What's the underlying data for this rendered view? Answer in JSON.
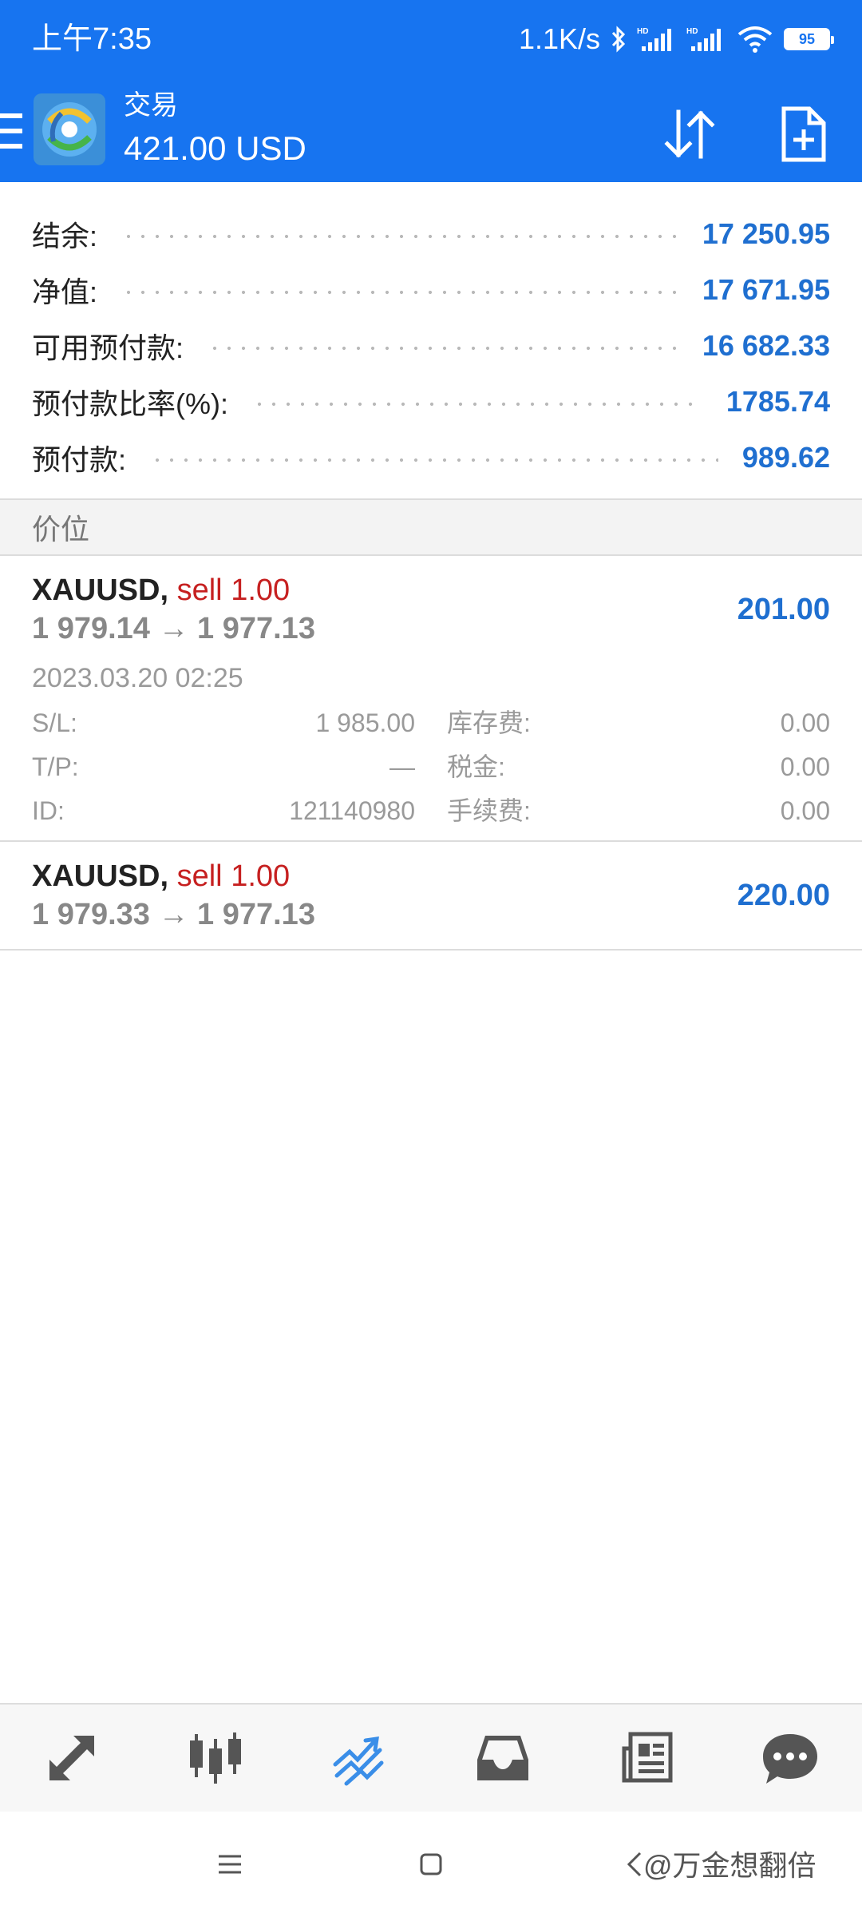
{
  "status_bar": {
    "time": "上午7:35",
    "net_speed": "1.1K/s",
    "battery": "95"
  },
  "app_bar": {
    "title": "交易",
    "subtitle": "421.00 USD"
  },
  "summary": [
    {
      "label": "结余:",
      "value": "17 250.95"
    },
    {
      "label": "净值:",
      "value": "17 671.95"
    },
    {
      "label": "可用预付款:",
      "value": "16 682.33"
    },
    {
      "label": "预付款比率(%):",
      "value": "1785.74"
    },
    {
      "label": "预付款:",
      "value": "989.62"
    }
  ],
  "section_header": "价位",
  "positions": [
    {
      "symbol": "XAUUSD,",
      "side": "sell",
      "lots": "1.00",
      "prices": "1 979.14 → 1 977.13",
      "profit": "201.00",
      "time": "2023.03.20 02:25",
      "details": {
        "sl_label": "S/L:",
        "sl_value": "1 985.00",
        "tp_label": "T/P:",
        "tp_value": "—",
        "id_label": "ID:",
        "id_value": "121140980",
        "swap_label": "库存费:",
        "swap_value": "0.00",
        "tax_label": "税金:",
        "tax_value": "0.00",
        "commission_label": "手续费:",
        "commission_value": "0.00"
      }
    },
    {
      "symbol": "XAUUSD,",
      "side": "sell",
      "lots": "1.00",
      "prices": "1 979.33 → 1 977.13",
      "profit": "220.00"
    }
  ],
  "bottom_nav": [
    {
      "name": "quotes",
      "icon": "arrows-diagonal-icon",
      "active": false
    },
    {
      "name": "chart",
      "icon": "candlestick-icon",
      "active": false
    },
    {
      "name": "trade",
      "icon": "trade-trend-icon",
      "active": true
    },
    {
      "name": "history",
      "icon": "inbox-icon",
      "active": false
    },
    {
      "name": "news",
      "icon": "newspaper-icon",
      "active": false
    },
    {
      "name": "messages",
      "icon": "chat-bubble-icon",
      "active": false
    }
  ],
  "watermark": "@万金想翻倍",
  "colors": {
    "primary": "#1774f0",
    "value_blue": "#1f6fd0",
    "sell_red": "#c62020",
    "muted": "#9a9a9a",
    "nav_icon": "#555555"
  }
}
